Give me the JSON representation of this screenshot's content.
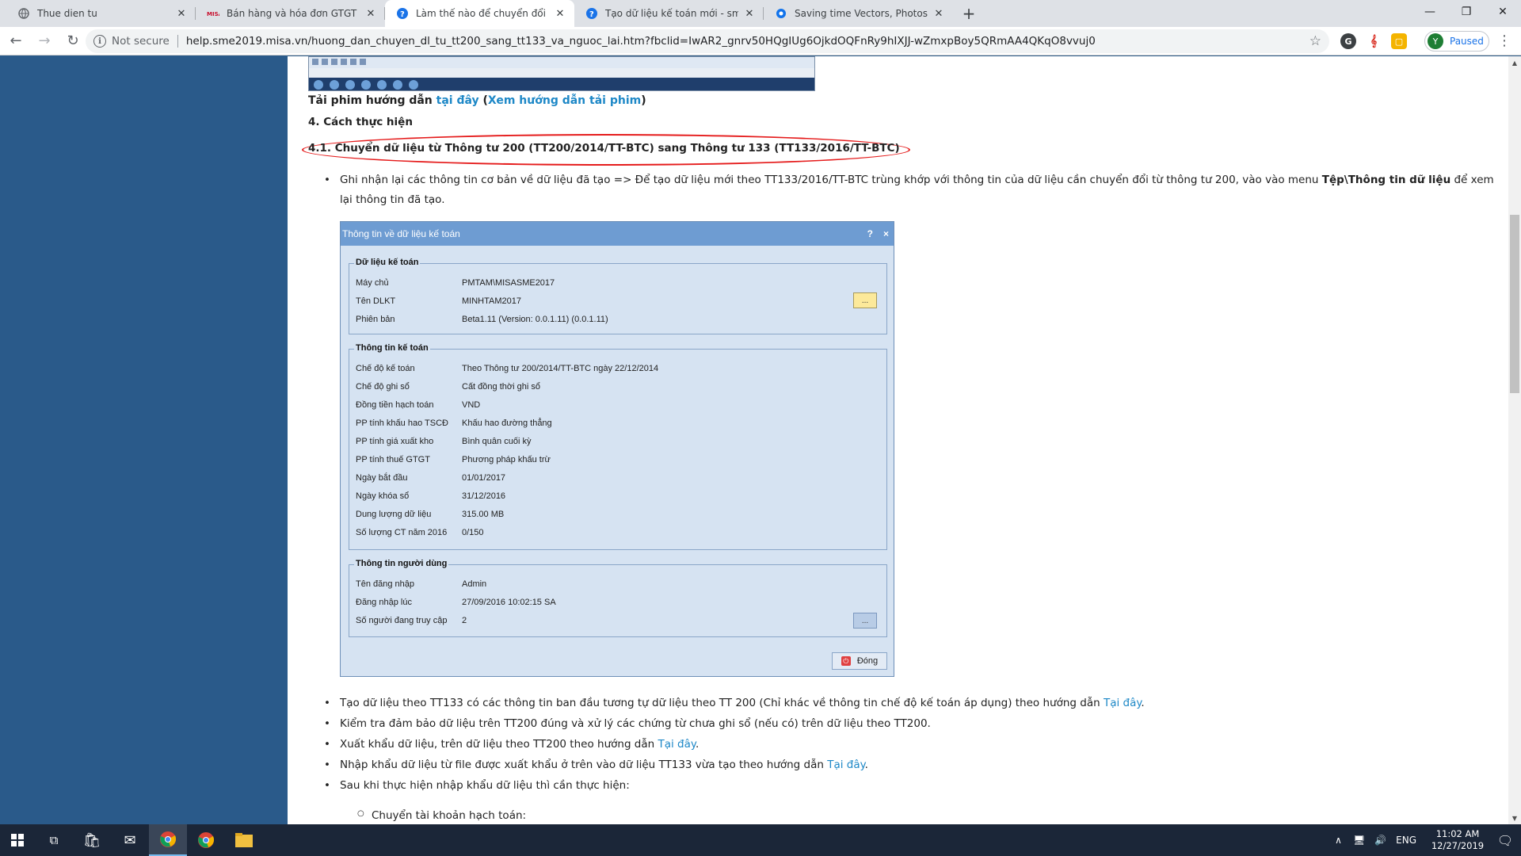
{
  "browser": {
    "tabs": [
      {
        "title": "Thue dien tu",
        "icon": "globe-icon"
      },
      {
        "title": "Bán hàng và hóa đơn GTGT | Foru",
        "icon": "misa-icon"
      },
      {
        "title": "Làm thế nào để chuyển đổi dữ liệ",
        "icon": "help-icon",
        "active": true
      },
      {
        "title": "Tạo dữ liệu kế toán mới - sme",
        "icon": "help-icon"
      },
      {
        "title": "Saving time Vectors, Photos and",
        "icon": "freepik-icon"
      }
    ],
    "new_tab": "+",
    "security": "Not secure",
    "url": "help.sme2019.misa.vn/huong_dan_chuyen_dl_tu_tt200_sang_tt133_va_nguoc_lai.htm?fbclid=IwAR2_gnrv50HQgIUg6OjkdOQFnRy9hIXJJ-wZmxpBoy5QRmAA4QKqO8vvuj0",
    "profile_initial": "Y",
    "profile_status": "Paused"
  },
  "article": {
    "download_prefix": "Tải phim hướng dẫn",
    "download_link": "tại đây",
    "download_paren_open": "(",
    "download_guide_link": "Xem hướng dẫn tải phim",
    "download_paren_close": ")",
    "section_title": "4. Cách thực hiện",
    "subsection_title": "4.1. Chuyển dữ liệu từ Thông tư 200 (TT200/2014/TT-BTC) sang Thông tư 133 (TT133/2016/TT-BTC)",
    "bullet1_a": "Ghi nhận lại các thông tin cơ bản về dữ liệu đã tạo => Để tạo dữ liệu mới theo TT133/2016/TT-BTC trùng khớp với thông tin của dữ liệu cần chuyển đổi từ thông tư 200, vào vào menu ",
    "bullet1_b": "Tệp\\Thông tin dữ liệu",
    "bullet1_c": " để xem",
    "bullet1_d": "lại thông tin đã tạo.",
    "bullets": [
      {
        "text": "Tạo dữ liệu theo TT133 có các thông tin ban đầu tương tự dữ liệu theo TT 200 (Chỉ khác về thông tin chế độ kế toán áp dụng) theo hướng dẫn ",
        "link": "Tại đây",
        "tail": "."
      },
      {
        "text": "Kiểm tra đảm bảo dữ liệu trên TT200 đúng và xử lý các chứng từ chưa ghi sổ (nếu có) trên dữ liệu theo TT200.",
        "link": "",
        "tail": ""
      },
      {
        "text": "Xuất khẩu dữ liệu, trên dữ liệu theo TT200 theo hướng dẫn ",
        "link": "Tại đây",
        "tail": "."
      },
      {
        "text": "Nhập khẩu dữ liệu từ file được xuất khẩu ở trên vào dữ liệu TT133 vừa tạo theo hướng dẫn ",
        "link": "Tại đây",
        "tail": "."
      },
      {
        "text": "Sau khi thực hiện nhập khẩu dữ liệu thì cần thực hiện:",
        "link": "",
        "tail": ""
      }
    ],
    "sub_bullet": "Chuyển tài khoản hạch toán:"
  },
  "dialog": {
    "title": "Thông tin về dữ liệu kế toán",
    "help": "?",
    "close_x": "×",
    "group1": {
      "legend": "Dữ liệu kế toán",
      "rows": [
        {
          "label": "Máy chủ",
          "value": "PMTAM\\MISASME2017"
        },
        {
          "label": "Tên DLKT",
          "value": "MINHTAM2017"
        },
        {
          "label": "Phiên bản",
          "value": "Beta1.11 (Version: 0.0.1.11) (0.0.1.11)"
        }
      ],
      "button": "..."
    },
    "group2": {
      "legend": "Thông tin kế toán",
      "rows": [
        {
          "label": "Chế độ kế toán",
          "value": "Theo Thông tư 200/2014/TT-BTC ngày 22/12/2014"
        },
        {
          "label": "Chế độ ghi sổ",
          "value": "Cất đồng thời ghi sổ"
        },
        {
          "label": "Đồng tiền hạch toán",
          "value": "VND"
        },
        {
          "label": "PP tính khấu hao TSCĐ",
          "value": "Khấu hao đường thẳng"
        },
        {
          "label": "PP tính giá xuất kho",
          "value": "Bình quân cuối kỳ"
        },
        {
          "label": "PP tính thuế GTGT",
          "value": "Phương pháp khấu trừ"
        },
        {
          "label": "Ngày bắt đầu",
          "value": "01/01/2017"
        },
        {
          "label": "Ngày khóa sổ",
          "value": "31/12/2016"
        },
        {
          "label": "Dung lượng dữ liệu",
          "value": "315.00 MB"
        },
        {
          "label": "Số lượng CT năm 2016",
          "value": "0/150"
        }
      ]
    },
    "group3": {
      "legend": "Thông tin người dùng",
      "rows": [
        {
          "label": "Tên đăng nhập",
          "value": "Admin"
        },
        {
          "label": "Đăng nhập lúc",
          "value": "27/09/2016 10:02:15 SA"
        },
        {
          "label": "Số người đang truy cập",
          "value": "2"
        }
      ],
      "button": "..."
    },
    "close_label": "Đóng"
  },
  "taskbar": {
    "language": "ENG",
    "time": "11:02 AM",
    "date": "12/27/2019"
  }
}
